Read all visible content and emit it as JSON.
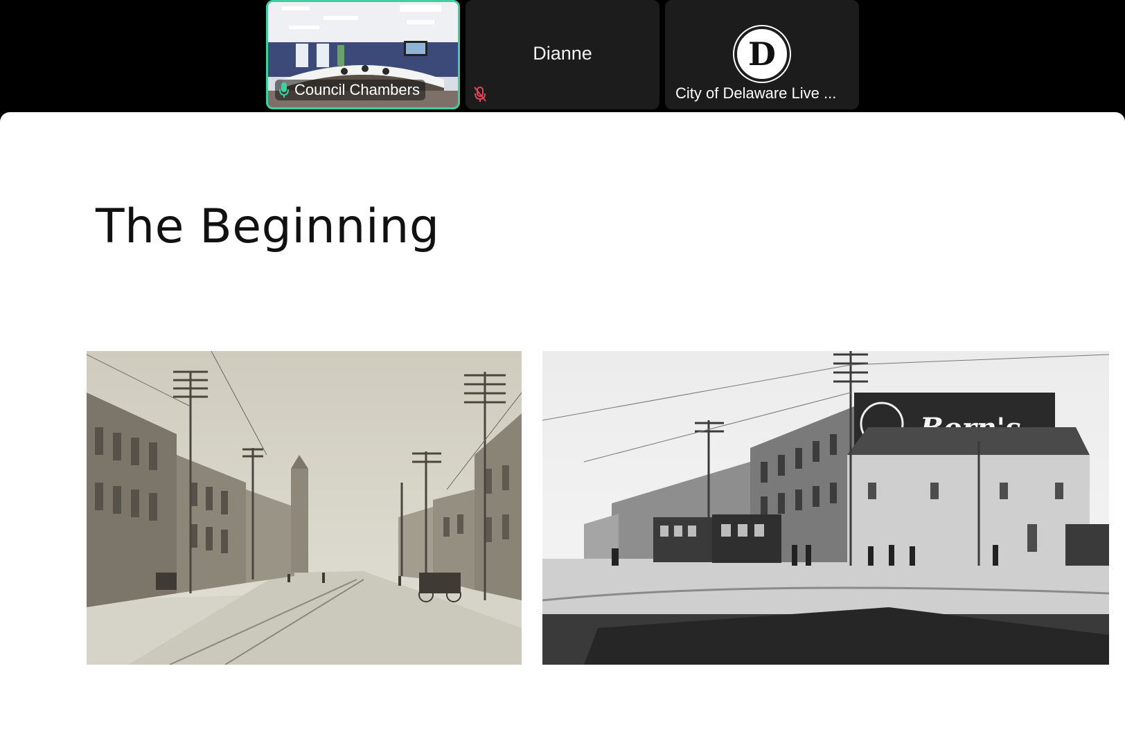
{
  "participants": [
    {
      "name": "Council Chambers",
      "mic": "on",
      "active": true
    },
    {
      "name": "Dianne",
      "mic": "muted",
      "active": false
    },
    {
      "name": "City of Delaware Live ...",
      "logo_letter": "D",
      "active": false
    }
  ],
  "slide": {
    "title": "The Beginning",
    "photos": [
      {
        "subject": "historic-main-street-photo"
      },
      {
        "subject": "historic-streetcar-corner-photo",
        "sign_text": "Born's"
      }
    ]
  },
  "colors": {
    "active_border": "#3fd0a0",
    "muted_icon": "#e2445c",
    "tile_bg": "#1c1c1c",
    "slide_bg": "#ffffff"
  }
}
